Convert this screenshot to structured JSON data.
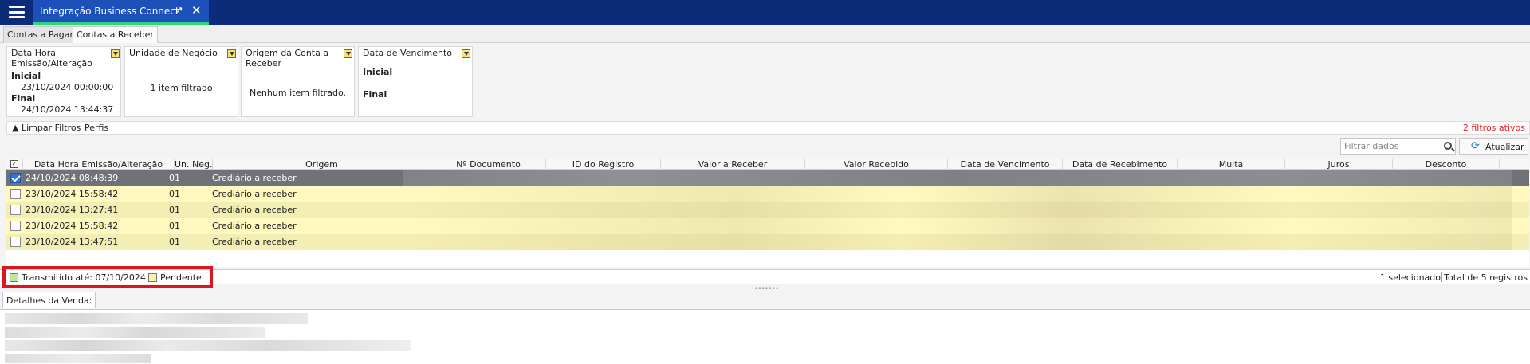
{
  "window": {
    "tab_title": "Integração Business Connect",
    "popout_icon": "↗",
    "close_icon": "✕"
  },
  "subtabs": [
    "Contas a Pagar",
    "Contas a Receber"
  ],
  "filters": {
    "emissao": {
      "title": "Data Hora Emissão/Alteração",
      "inicial_label": "Inicial",
      "inicial_value": "23/10/2024 00:00:00",
      "final_label": "Final",
      "final_value": "24/10/2024 13:44:37"
    },
    "unidade": {
      "title": "Unidade de Negócio",
      "status": "1 item filtrado"
    },
    "origem": {
      "title": "Origem da Conta a Receber",
      "status": "Nenhum item filtrado."
    },
    "vencimento": {
      "title": "Data de Vencimento",
      "inicial_label": "Inicial",
      "final_label": "Final"
    }
  },
  "filterbar": {
    "clear_label": "Limpar Filtros",
    "profiles_label": "Perfis",
    "active_count": "2 filtros ativos"
  },
  "toolbar": {
    "search_placeholder": "Filtrar dados",
    "refresh_label": "Atualizar"
  },
  "table": {
    "columns": [
      "Data Hora Emissão/Alteração",
      "Un. Neg.",
      "Origem",
      "Nº Documento",
      "ID do Registro",
      "Valor a Receber",
      "Valor Recebido",
      "Data de Vencimento",
      "Data de Recebimento",
      "Multa",
      "Juros",
      "Desconto"
    ],
    "rows": [
      {
        "selected": true,
        "data_hora": "24/10/2024 08:48:39",
        "un_neg": "01",
        "origem": "Crediário a receber"
      },
      {
        "selected": false,
        "data_hora": "23/10/2024 15:58:42",
        "un_neg": "01",
        "origem": "Crediário a receber"
      },
      {
        "selected": false,
        "data_hora": "23/10/2024 13:27:41",
        "un_neg": "01",
        "origem": "Crediário a receber"
      },
      {
        "selected": false,
        "data_hora": "23/10/2024 15:58:42",
        "un_neg": "01",
        "origem": "Crediário a receber"
      },
      {
        "selected": false,
        "data_hora": "23/10/2024 13:47:51",
        "un_neg": "01",
        "origem": "Crediário a receber"
      }
    ]
  },
  "legend": {
    "transmitted": {
      "label": "Transmitido até: 07/10/2024",
      "color": "#bde5a4"
    },
    "pending": {
      "label": "Pendente",
      "color": "#fff1a8"
    }
  },
  "status": {
    "selected": "1 selecionado",
    "total": "Total de 5 registros"
  },
  "details": {
    "tab_label": "Detalhes da Venda:"
  }
}
